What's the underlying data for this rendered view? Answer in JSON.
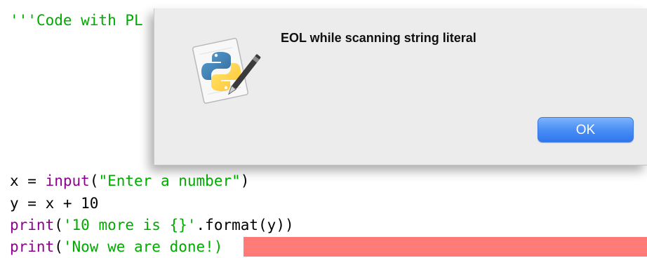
{
  "editor": {
    "lines": [
      {
        "string": "'''Code with PL"
      },
      {
        "var": "x",
        "op": " = ",
        "builtin": "input",
        "open": "(",
        "string": "\"Enter a number\"",
        "close": ")"
      },
      {
        "text": "y = x + 10"
      },
      {
        "builtin": "print",
        "open": "(",
        "string": "'10 more is {}'",
        "rest": ".format(y))"
      },
      {
        "builtin": "print",
        "open": "(",
        "string": "'Now we are done!)"
      }
    ],
    "colors": {
      "string": "#00aa00",
      "builtin": "#900090",
      "error_highlight": "#ff7b78"
    }
  },
  "dialog": {
    "message": "EOL while scanning string literal",
    "ok_label": "OK",
    "icon": "python-script-icon",
    "button_color": "#3d86f5"
  }
}
